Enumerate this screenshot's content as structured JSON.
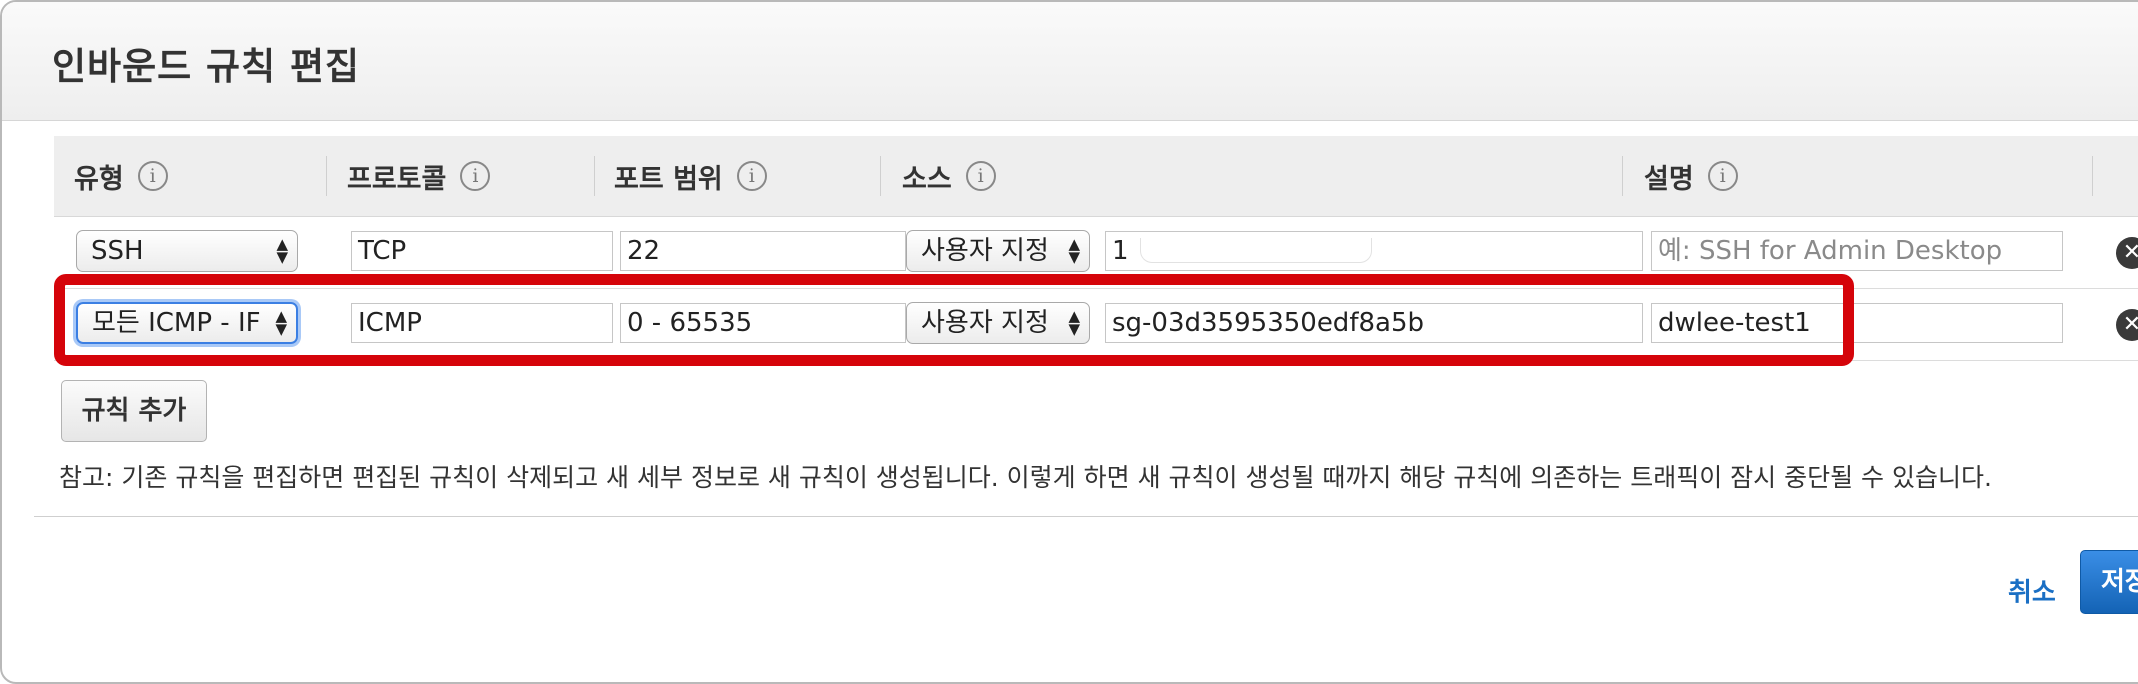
{
  "dialog": {
    "title": "인바운드 규칙 편집"
  },
  "columns": [
    {
      "label": "유형"
    },
    {
      "label": "프로토콜"
    },
    {
      "label": "포트 범위"
    },
    {
      "label": "소스"
    },
    {
      "label": "설명"
    }
  ],
  "info_glyph": "i",
  "rows": [
    {
      "type": "SSH",
      "protocol": "TCP",
      "port_range": "22",
      "source_type": "사용자 지정",
      "source_value": "1",
      "description": "",
      "description_placeholder": "예: SSH for Admin Desktop"
    },
    {
      "type": "모든 ICMP - IF",
      "protocol": "ICMP",
      "port_range": "0 - 65535",
      "source_type": "사용자 지정",
      "source_value": "sg-03d3595350edf8a5b",
      "description": "dwlee-test1",
      "description_placeholder": ""
    }
  ],
  "select_arrows": "▲▼",
  "delete_glyph": "✕",
  "add_rule_label": "규칙 추가",
  "note": "참고: 기존 규칙을 편집하면 편집된 규칙이 삭제되고 새 세부 정보로 새 규칙이 생성됩니다. 이렇게 하면 새 규칙이 생성될 때까지 해당 규칙에 의존하는 트래픽이 잠시 중단될 수 있습니다.",
  "footer": {
    "cancel_label": "취소",
    "save_label": "저장"
  },
  "colors": {
    "highlight": "#d5040a",
    "link": "#1a6fc4",
    "primary": "#1a73c9"
  }
}
